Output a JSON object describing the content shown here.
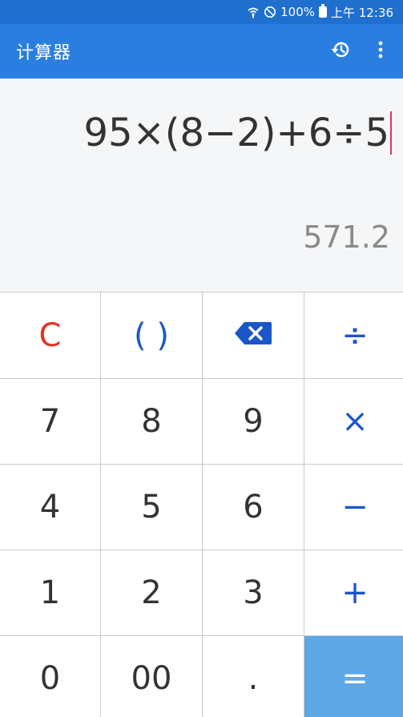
{
  "status_bar": {
    "battery": "100%",
    "time": "上午 12:36",
    "icons": [
      "wifi-call-icon",
      "do-not-disturb-icon",
      "battery-icon"
    ]
  },
  "app_bar": {
    "title": "计算器",
    "actions": [
      "history-icon",
      "more-vert-icon"
    ]
  },
  "display": {
    "expression": "95×(8−2)+6÷5",
    "result": "571.2"
  },
  "keypad": {
    "row1": [
      "C",
      "( )",
      "backspace-icon",
      "÷"
    ],
    "row2": [
      "7",
      "8",
      "9",
      "×"
    ],
    "row3": [
      "4",
      "5",
      "6",
      "−"
    ],
    "row4": [
      "1",
      "2",
      "3",
      "+"
    ],
    "row5": [
      "0",
      "00",
      ".",
      "="
    ]
  },
  "colors": {
    "status_bar": "#1f6fcf",
    "app_bar": "#2a7ee0",
    "operator": "#1a56c8",
    "clear": "#e03525",
    "equals_bg": "#5ea8e6",
    "cursor": "#e0345f"
  }
}
